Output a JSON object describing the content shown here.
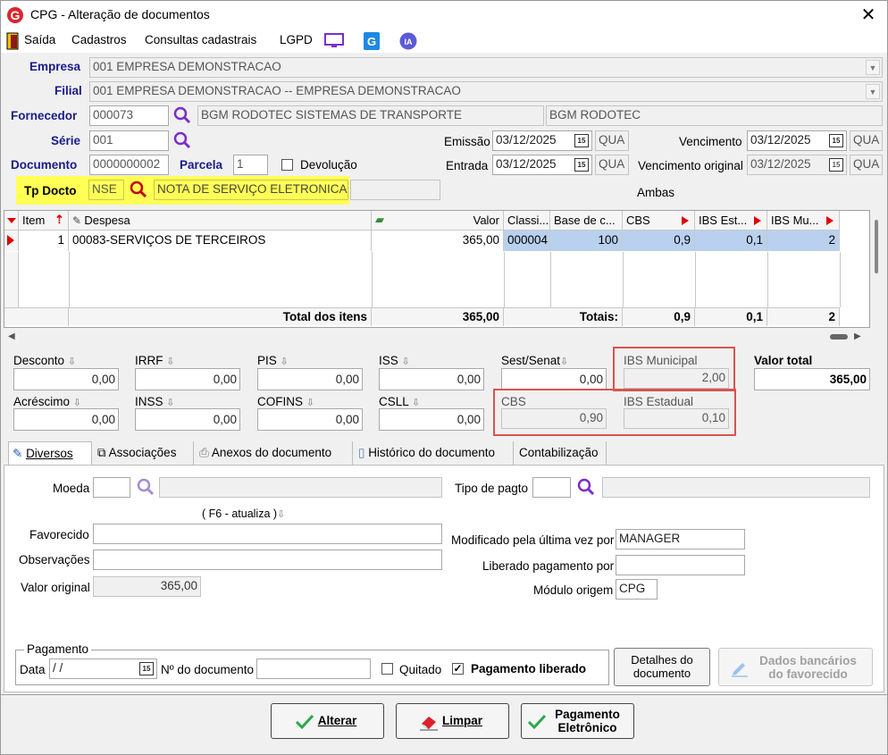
{
  "window": {
    "title": "CPG - Alteração de documentos",
    "close": "✕"
  },
  "menu": {
    "items": [
      "Saída",
      "Cadastros",
      "Consultas cadastrais",
      "LGPD"
    ]
  },
  "form": {
    "empresa_label": "Empresa",
    "empresa_value": "001 EMPRESA DEMONSTRACAO",
    "filial_label": "Filial",
    "filial_value": "001 EMPRESA DEMONSTRACAO -- EMPRESA DEMONSTRACAO",
    "fornecedor_label": "Fornecedor",
    "fornecedor_code": "000073",
    "fornecedor_name": "BGM RODOTEC SISTEMAS DE TRANSPORTE",
    "fornecedor_short": "BGM RODOTEC",
    "serie_label": "Série",
    "serie_value": "001",
    "documento_label": "Documento",
    "documento_value": "0000000002",
    "parcela_label": "Parcela",
    "parcela_value": "1",
    "devolucao_label": "Devolução",
    "tpdocto_label": "Tp Docto",
    "tpdocto_code": "NSE",
    "tpdocto_name": "NOTA DE SERVIÇO ELETRONICA",
    "emissao_label": "Emissão",
    "emissao_value": "03/12/2025",
    "emissao_day": "QUA",
    "entrada_label": "Entrada",
    "entrada_value": "03/12/2025",
    "entrada_day": "QUA",
    "vencimento_label": "Vencimento",
    "vencimento_value": "03/12/2025",
    "vencimento_day": "QUA",
    "venc_original_label": "Vencimento original",
    "venc_original_value": "03/12/2025",
    "venc_original_day": "QUA",
    "ambas": "Ambas",
    "cal_badge": "15"
  },
  "grid": {
    "headers": [
      "Item",
      "Despesa",
      "Valor",
      "Classi...",
      "Base de c...",
      "CBS",
      "IBS Est...",
      "IBS Mu..."
    ],
    "row": {
      "item": "1",
      "despesa": "00083-SERVIÇOS DE TERCEIROS",
      "valor": "365,00",
      "classi": "000004",
      "base": "100",
      "cbs": "0,9",
      "ibs_est": "0,1",
      "ibs_mu": "2"
    },
    "totals": {
      "label_itens": "Total dos itens",
      "valor": "365,00",
      "label_totais": "Totais:",
      "cbs": "0,9",
      "ibs_est": "0,1",
      "ibs_mu": "2"
    }
  },
  "taxes": {
    "desconto_label": "Desconto",
    "desconto": "0,00",
    "irrf_label": "IRRF",
    "irrf": "0,00",
    "pis_label": "PIS",
    "pis": "0,00",
    "iss_label": "ISS",
    "iss": "0,00",
    "sest_label": "Sest/Senat",
    "sest": "0,00",
    "ibs_mun_label": "IBS Municipal",
    "ibs_mun": "2,00",
    "valor_total_label": "Valor total",
    "valor_total": "365,00",
    "acrescimo_label": "Acréscimo",
    "acrescimo": "0,00",
    "inss_label": "INSS",
    "inss": "0,00",
    "cofins_label": "COFINS",
    "cofins": "0,00",
    "csll_label": "CSLL",
    "csll": "0,00",
    "cbs_label": "CBS",
    "cbs": "0,90",
    "ibs_est_label": "IBS Estadual",
    "ibs_est": "0,10"
  },
  "tabs": [
    "Diversos",
    "Associações",
    "Anexos do documento",
    "Histórico do documento",
    "Contabilização"
  ],
  "diversos": {
    "moeda_label": "Moeda",
    "tipo_pagto_label": "Tipo de pagto",
    "f6": "( F6 - atualiza )",
    "favorecido_label": "Favorecido",
    "observacoes_label": "Observações",
    "valor_original_label": "Valor original",
    "valor_original": "365,00",
    "modificado_label": "Modificado pela última vez por",
    "modificado": "MANAGER",
    "liberado_label": "Liberado pagamento por",
    "liberado": "",
    "modulo_label": "Módulo origem",
    "modulo": "CPG"
  },
  "pagamento": {
    "group": "Pagamento",
    "data_label": "Data",
    "data_value": " /  /",
    "ndoc_label": "Nº do documento",
    "quitado_label": "Quitado",
    "liberado_label": "Pagamento liberado",
    "detalhes_btn": "Detalhes do documento",
    "dados_btn": "Dados bancários do favorecido"
  },
  "buttons": {
    "alterar": "Alterar",
    "limpar": "Limpar",
    "pagamento": "Pagamento Eletrônico"
  },
  "colors": {
    "accent": "#1a1a8a",
    "highlight": "#ffff55",
    "selected_row": "#b9d1ee",
    "red_box": "#d9534f",
    "magnifier": "#7b2ec9"
  }
}
